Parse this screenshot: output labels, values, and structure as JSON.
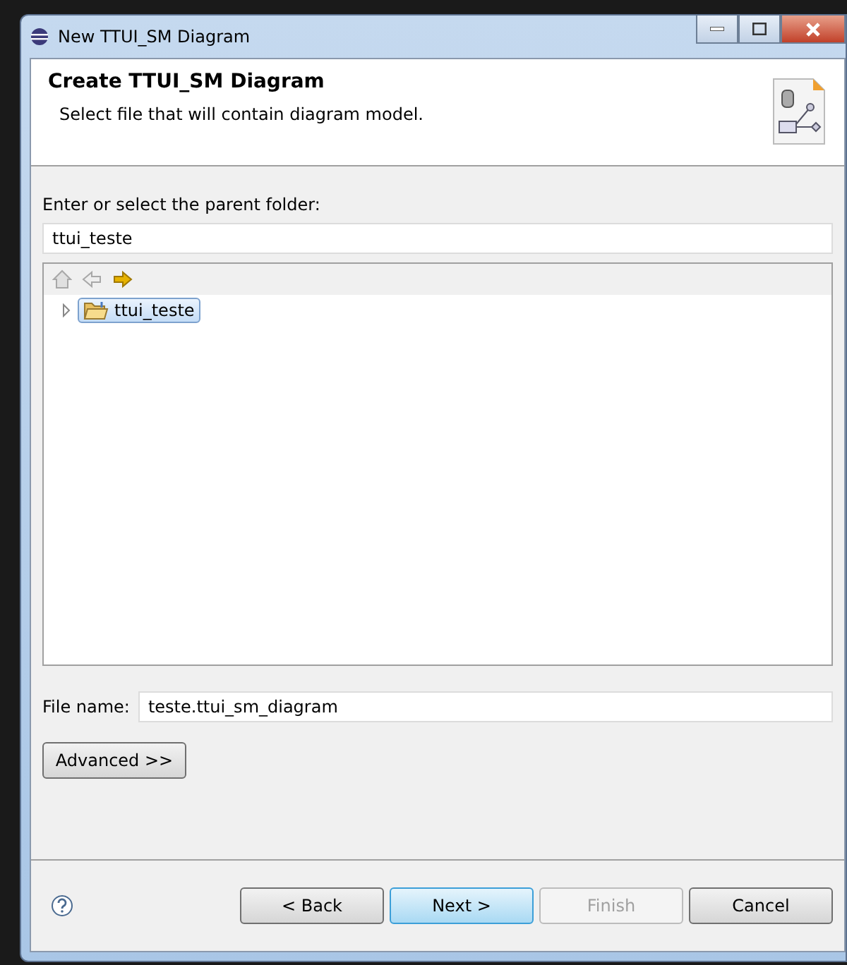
{
  "window": {
    "title": "New TTUI_SM Diagram"
  },
  "header": {
    "title": "Create TTUI_SM Diagram",
    "description": "Select file that will contain diagram model."
  },
  "folder": {
    "label": "Enter or select the parent folder:",
    "value": "ttui_teste"
  },
  "tree": {
    "nav": [
      {
        "kind": "home",
        "disabled": true
      },
      {
        "kind": "back",
        "disabled": true
      },
      {
        "kind": "forward",
        "disabled": false
      }
    ],
    "items": [
      {
        "label": "ttui_teste",
        "expanded": false,
        "selected": true
      }
    ]
  },
  "file_name": {
    "label": "File name:",
    "value": "teste.ttui_sm_diagram"
  },
  "advanced_button": "Advanced >>",
  "buttons": [
    {
      "label": "< Back",
      "disabled": false,
      "default": false
    },
    {
      "label": "Next >",
      "disabled": false,
      "default": true
    },
    {
      "label": "Finish",
      "disabled": true,
      "default": false
    },
    {
      "label": "Cancel",
      "disabled": false,
      "default": false
    }
  ]
}
